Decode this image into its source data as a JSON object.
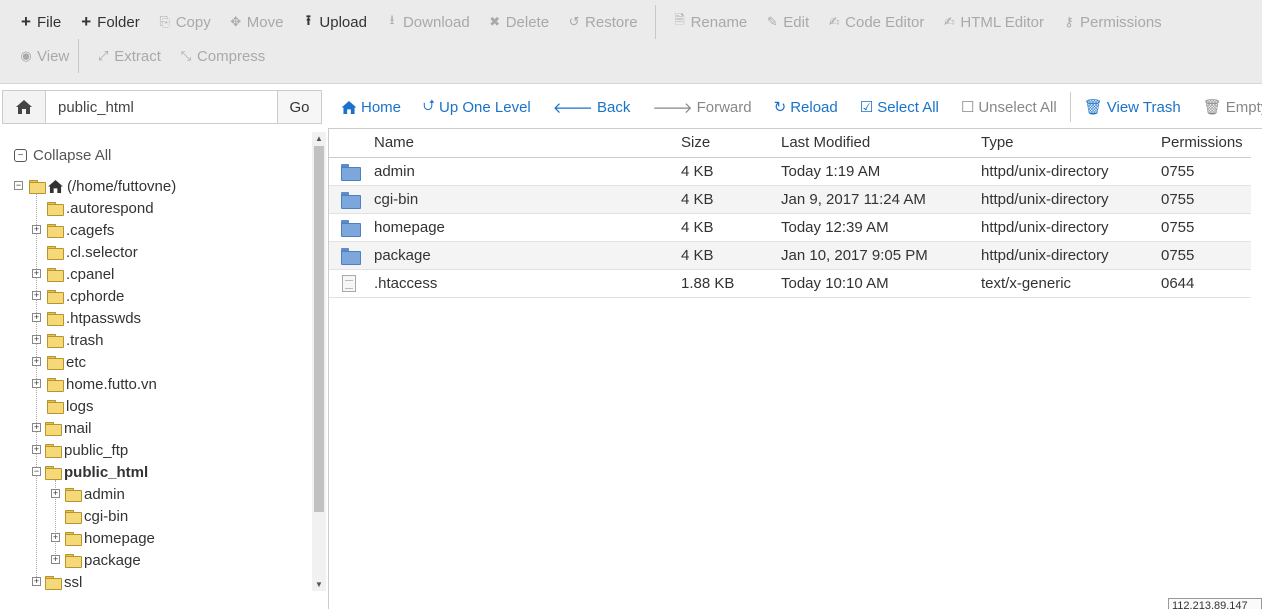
{
  "toolbar": {
    "row1": [
      {
        "label": "File",
        "icon": "plus-icon",
        "active": true
      },
      {
        "label": "Folder",
        "icon": "plus-icon",
        "active": true
      },
      {
        "label": "Copy",
        "icon": "copy-icon",
        "active": false
      },
      {
        "label": "Move",
        "icon": "move-icon",
        "active": false
      },
      {
        "label": "Upload",
        "icon": "upload-icon",
        "active": true
      },
      {
        "label": "Download",
        "icon": "download-icon",
        "active": false
      },
      {
        "label": "Delete",
        "icon": "delete-icon",
        "active": false
      },
      {
        "label": "Restore",
        "icon": "restore-icon",
        "active": false
      },
      {
        "label": "Rename",
        "icon": "rename-icon",
        "active": false
      },
      {
        "label": "Edit",
        "icon": "edit-icon",
        "active": false
      },
      {
        "label": "Code Editor",
        "icon": "code-editor-icon",
        "active": false
      },
      {
        "label": "HTML Editor",
        "icon": "html-editor-icon",
        "active": false
      },
      {
        "label": "Permissions",
        "icon": "key-icon",
        "active": false
      }
    ],
    "row2": [
      {
        "label": "View",
        "icon": "eye-icon",
        "active": false
      },
      {
        "label": "Extract",
        "icon": "extract-icon",
        "active": false
      },
      {
        "label": "Compress",
        "icon": "compress-icon",
        "active": false
      }
    ]
  },
  "pathbar": {
    "path_value": "public_html",
    "go_label": "Go"
  },
  "navbar": {
    "home": "Home",
    "up_one_level": "Up One Level",
    "back": "Back",
    "forward": "Forward",
    "reload": "Reload",
    "select_all": "Select All",
    "unselect_all": "Unselect All",
    "view_trash": "View Trash",
    "empty_trash": "Empty Trash"
  },
  "tree": {
    "collapse_all": "Collapse All",
    "root": "(/home/futtovne)",
    "items": [
      {
        "label": ".autorespond",
        "expandable": false
      },
      {
        "label": ".cagefs",
        "expandable": true
      },
      {
        "label": ".cl.selector",
        "expandable": false
      },
      {
        "label": ".cpanel",
        "expandable": true
      },
      {
        "label": ".cphorde",
        "expandable": true
      },
      {
        "label": ".htpasswds",
        "expandable": true
      },
      {
        "label": ".trash",
        "expandable": true
      },
      {
        "label": "etc",
        "expandable": true
      },
      {
        "label": "home.futto.vn",
        "expandable": true
      },
      {
        "label": "logs",
        "expandable": false
      },
      {
        "label": "mail",
        "expandable": true
      },
      {
        "label": "public_ftp",
        "expandable": true
      },
      {
        "label": "public_html",
        "expandable": true,
        "expanded": true,
        "selected": true
      },
      {
        "label": "ssl",
        "expandable": true
      }
    ],
    "public_html_children": [
      {
        "label": "admin",
        "expandable": true
      },
      {
        "label": "cgi-bin",
        "expandable": false
      },
      {
        "label": "homepage",
        "expandable": true
      },
      {
        "label": "package",
        "expandable": true
      }
    ]
  },
  "files": {
    "headers": {
      "name": "Name",
      "size": "Size",
      "modified": "Last Modified",
      "type": "Type",
      "permissions": "Permissions"
    },
    "rows": [
      {
        "kind": "folder",
        "name": "admin",
        "size": "4 KB",
        "modified": "Today 1:19 AM",
        "type": "httpd/unix-directory",
        "permissions": "0755"
      },
      {
        "kind": "folder",
        "name": "cgi-bin",
        "size": "4 KB",
        "modified": "Jan 9, 2017 11:24 AM",
        "type": "httpd/unix-directory",
        "permissions": "0755"
      },
      {
        "kind": "folder",
        "name": "homepage",
        "size": "4 KB",
        "modified": "Today 12:39 AM",
        "type": "httpd/unix-directory",
        "permissions": "0755"
      },
      {
        "kind": "folder",
        "name": "package",
        "size": "4 KB",
        "modified": "Jan 10, 2017 9:05 PM",
        "type": "httpd/unix-directory",
        "permissions": "0755"
      },
      {
        "kind": "file",
        "name": ".htaccess",
        "size": "1.88 KB",
        "modified": "Today 10:10 AM",
        "type": "text/x-generic",
        "permissions": "0644"
      }
    ]
  },
  "ip_label": "112.213.89.147",
  "colors": {
    "link": "#1a73c8",
    "toolbar_bg": "#ebebeb",
    "folder_blue": "#7ba7dd",
    "folder_yellow": "#f5d878"
  }
}
